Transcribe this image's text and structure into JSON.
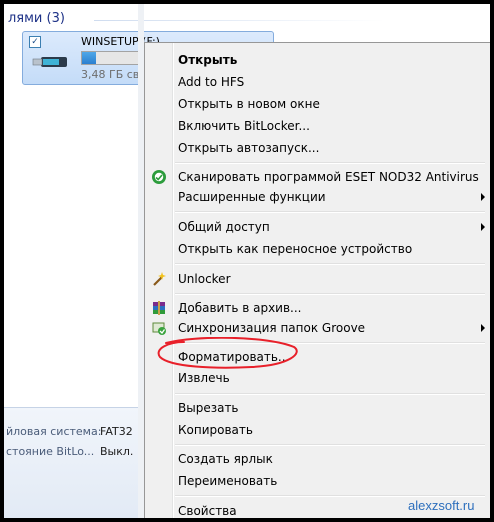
{
  "explorer": {
    "group_header": "лями (3)",
    "drive": {
      "name": "WINSETUP (F:)",
      "size_text": "3,48 ГБ сво",
      "used_fraction": 0.08
    },
    "details": {
      "fs_label": "йловая система:",
      "fs_value": "FAT32",
      "bitlocker_label": "стояние BitLo...",
      "bitlocker_value": "Выкл."
    }
  },
  "context_menu": {
    "items": [
      {
        "label": "Открыть",
        "bold": true
      },
      {
        "label": "Add to HFS"
      },
      {
        "label": "Открыть в новом окне"
      },
      {
        "label": "Включить BitLocker..."
      },
      {
        "label": "Открыть автозапуск..."
      },
      {
        "label": "Сканировать программой ESET NOD32 Antivirus",
        "icon": "eset-icon"
      },
      {
        "label": "Расширенные функции",
        "submenu": true
      },
      {
        "label": "Общий доступ",
        "submenu": true
      },
      {
        "label": "Открыть как переносное устройство"
      },
      {
        "label": "Unlocker",
        "icon": "unlocker-wand-icon"
      },
      {
        "label": "Добавить в архив...",
        "icon": "winrar-icon"
      },
      {
        "label": "Синхронизация папок Groove",
        "icon": "groove-sync-icon",
        "submenu": true
      },
      {
        "label": "Форматировать..."
      },
      {
        "label": "Извлечь"
      },
      {
        "label": "Вырезать"
      },
      {
        "label": "Копировать"
      },
      {
        "label": "Создать ярлык"
      },
      {
        "label": "Переименовать"
      },
      {
        "label": "Свойства"
      }
    ]
  },
  "annotation": {
    "highlight_color": "#e8202a"
  },
  "watermark": "alexzsoft.ru"
}
